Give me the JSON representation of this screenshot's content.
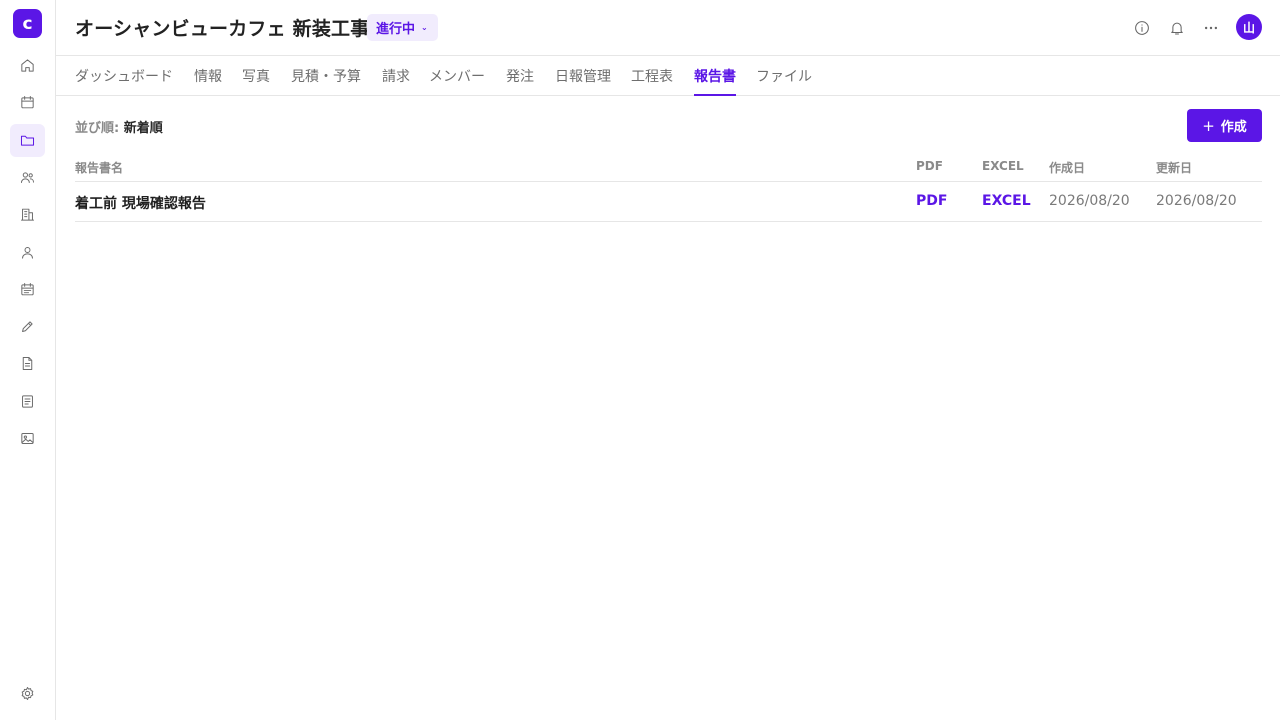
{
  "logo": {
    "letter": "c"
  },
  "colors": {
    "accent": "#5b16e6",
    "accent_light": "#f1ecfd"
  },
  "sidebar": {
    "items": [
      {
        "icon": "home-icon"
      },
      {
        "icon": "calendar-icon"
      },
      {
        "icon": "folder-icon",
        "active": true
      },
      {
        "icon": "users-icon"
      },
      {
        "icon": "building-icon"
      },
      {
        "icon": "user-icon"
      },
      {
        "icon": "schedule-icon"
      },
      {
        "icon": "pencil-icon"
      },
      {
        "icon": "document-icon"
      },
      {
        "icon": "list-document-icon"
      },
      {
        "icon": "image-icon"
      }
    ],
    "footer_icon": "gear-icon"
  },
  "header": {
    "title": "オーシャンビューカフェ 新装工事",
    "status": "進行中",
    "icons": [
      "info-icon",
      "bell-icon",
      "more-icon"
    ],
    "avatar": "山"
  },
  "tabs": [
    {
      "label": "ダッシュボード"
    },
    {
      "label": "情報"
    },
    {
      "label": "写真"
    },
    {
      "label": "見積・予算"
    },
    {
      "label": "請求"
    },
    {
      "label": "メンバー"
    },
    {
      "label": "発注"
    },
    {
      "label": "日報管理"
    },
    {
      "label": "工程表"
    },
    {
      "label": "報告書",
      "active": true
    },
    {
      "label": "ファイル"
    }
  ],
  "toolbar": {
    "sort_label": "並び順:",
    "sort_value": "新着順",
    "create_label": "作成"
  },
  "table": {
    "columns": [
      "報告書名",
      "PDF",
      "EXCEL",
      "作成日",
      "更新日"
    ],
    "rows": [
      {
        "name": "着工前 現場確認報告",
        "pdf": "PDF",
        "excel": "EXCEL",
        "created": "2026/08/20",
        "updated": "2026/08/20"
      }
    ]
  }
}
